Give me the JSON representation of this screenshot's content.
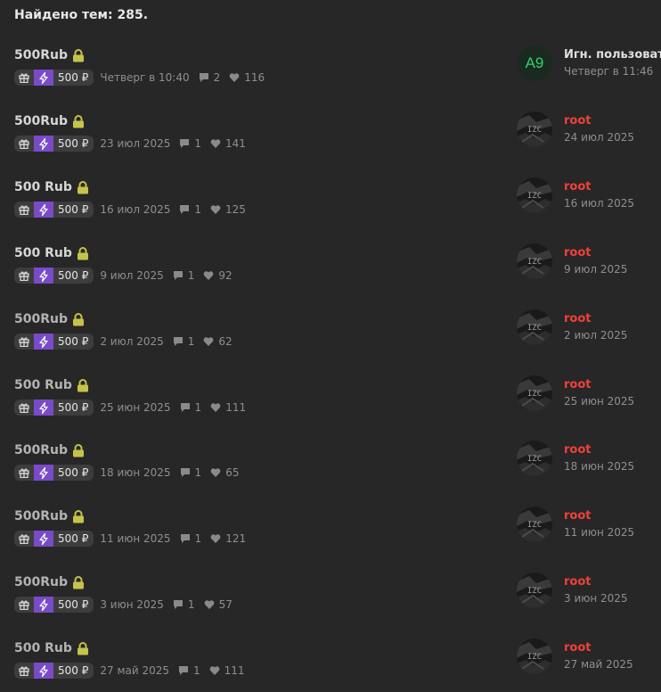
{
  "header": {
    "found_text": "Найдено тем: 285."
  },
  "colors": {
    "background": "#272727",
    "lock": "#c5c34a",
    "bolt_bg": "#7a4bc8",
    "username_red": "#f2403a"
  },
  "threads": [
    {
      "title": "500Rub",
      "price": "500 ₽",
      "date": "Четверг в 10:40",
      "replies": "2",
      "likes": "116",
      "user": "Игн. пользовате",
      "user_date": "Четверг в 11:46",
      "avatar_text": "A9"
    },
    {
      "title": "500Rub",
      "price": "500 ₽",
      "date": "23 июл 2025",
      "replies": "1",
      "likes": "141",
      "user": "root",
      "user_date": "24 июл 2025",
      "avatar_text": "IZC"
    },
    {
      "title": "500 Rub",
      "price": "500 ₽",
      "date": "16 июл 2025",
      "replies": "1",
      "likes": "125",
      "user": "root",
      "user_date": "16 июл 2025",
      "avatar_text": "IZC"
    },
    {
      "title": "500 Rub",
      "price": "500 ₽",
      "date": "9 июл 2025",
      "replies": "1",
      "likes": "92",
      "user": "root",
      "user_date": "9 июл 2025",
      "avatar_text": "IZC"
    },
    {
      "title": "500Rub",
      "price": "500 ₽",
      "date": "2 июл 2025",
      "replies": "1",
      "likes": "62",
      "user": "root",
      "user_date": "2 июл 2025",
      "avatar_text": "IZC"
    },
    {
      "title": "500 Rub",
      "price": "500 ₽",
      "date": "25 июн 2025",
      "replies": "1",
      "likes": "111",
      "user": "root",
      "user_date": "25 июн 2025",
      "avatar_text": "IZC"
    },
    {
      "title": "500Rub",
      "price": "500 ₽",
      "date": "18 июн 2025",
      "replies": "1",
      "likes": "65",
      "user": "root",
      "user_date": "18 июн 2025",
      "avatar_text": "IZC"
    },
    {
      "title": "500Rub",
      "price": "500 ₽",
      "date": "11 июн 2025",
      "replies": "1",
      "likes": "121",
      "user": "root",
      "user_date": "11 июн 2025",
      "avatar_text": "IZC"
    },
    {
      "title": "500Rub",
      "price": "500 ₽",
      "date": "3 июн 2025",
      "replies": "1",
      "likes": "57",
      "user": "root",
      "user_date": "3 июн 2025",
      "avatar_text": "IZC"
    },
    {
      "title": "500 Rub",
      "price": "500 ₽",
      "date": "27 май 2025",
      "replies": "1",
      "likes": "111",
      "user": "root",
      "user_date": "27 май 2025",
      "avatar_text": "IZC"
    }
  ]
}
